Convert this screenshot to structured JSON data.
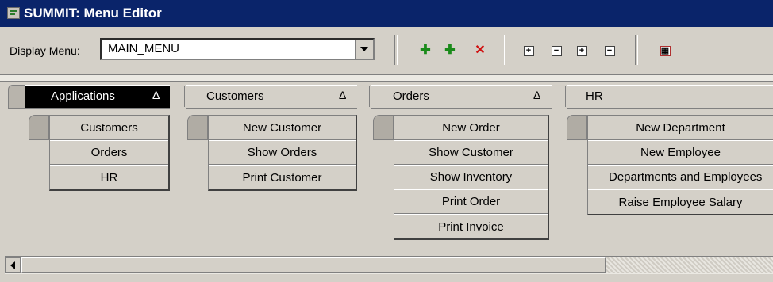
{
  "window": {
    "title": "SUMMIT: Menu Editor"
  },
  "toolbar": {
    "label": "Display Menu:",
    "menu_value": "MAIN_MENU"
  },
  "columns": [
    {
      "header": "Applications",
      "items": [
        "Customers",
        "Orders",
        "HR"
      ]
    },
    {
      "header": "Customers",
      "items": [
        "New Customer",
        "Show Orders",
        "Print Customer"
      ]
    },
    {
      "header": "Orders",
      "items": [
        "New Order",
        "Show Customer",
        "Show Inventory",
        "Print Order",
        "Print Invoice"
      ]
    },
    {
      "header": "HR",
      "items": [
        "New Department",
        "New Employee",
        "Departments and Employees",
        "Raise Employee Salary"
      ]
    }
  ],
  "symbols": {
    "collapse_arrow": "Δ"
  },
  "colors": {
    "title_bar": "#0a246a",
    "active_header": "#000000",
    "face": "#d4d0c8"
  }
}
